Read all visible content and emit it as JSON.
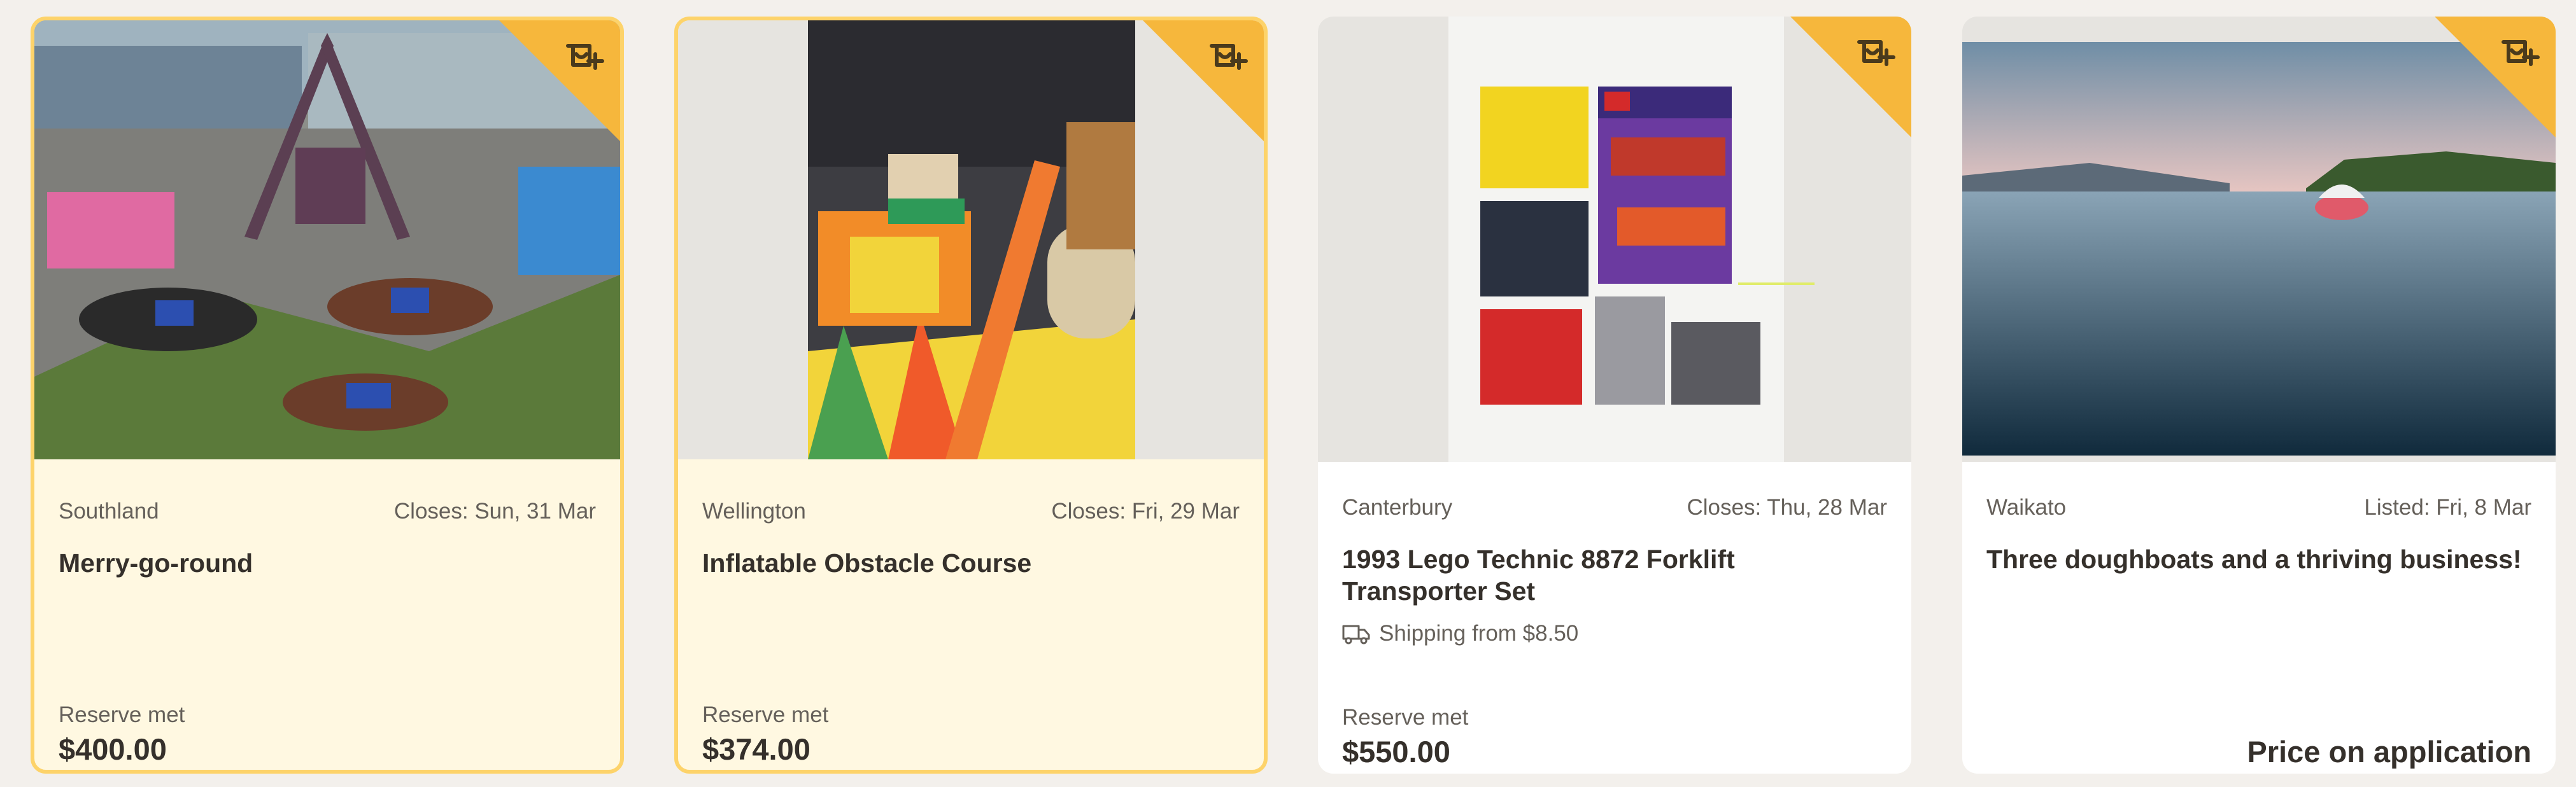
{
  "colors": {
    "featured_background": "#fff8e1",
    "featured_border": "#fdd36a",
    "watchlist_corner": "#f6b73c",
    "text_primary": "#35302b",
    "text_secondary": "#65605a"
  },
  "listings": [
    {
      "location": "Southland",
      "date_label": "Closes: Sun, 31 Mar",
      "title": "Merry-go-round",
      "reserve_status": "Reserve met",
      "price": "$400.00",
      "featured": true,
      "image": "carousel-horses-photo",
      "watchlist_icon": "add-to-watchlist-icon"
    },
    {
      "location": "Wellington",
      "date_label": "Closes: Fri, 29 Mar",
      "title": "Inflatable Obstacle Course",
      "reserve_status": "Reserve met",
      "price": "$374.00",
      "featured": true,
      "image": "inflatable-obstacle-photo",
      "watchlist_icon": "add-to-watchlist-icon"
    },
    {
      "location": "Canterbury",
      "date_label": "Closes: Thu, 28 Mar",
      "title": "1993 Lego Technic 8872 Forklift Transporter Set",
      "shipping": "Shipping from $8.50",
      "shipping_icon": "truck-icon",
      "reserve_status": "Reserve met",
      "price": "$550.00",
      "featured": false,
      "image": "lego-technic-photo",
      "watchlist_icon": "add-to-watchlist-icon"
    },
    {
      "location": "Waikato",
      "date_label": "Listed: Fri, 8 Mar",
      "title": "Three doughboats and a thriving business!",
      "price_label": "Price on application",
      "featured": false,
      "image": "lake-doughboat-photo",
      "watchlist_icon": "add-to-watchlist-icon"
    }
  ]
}
